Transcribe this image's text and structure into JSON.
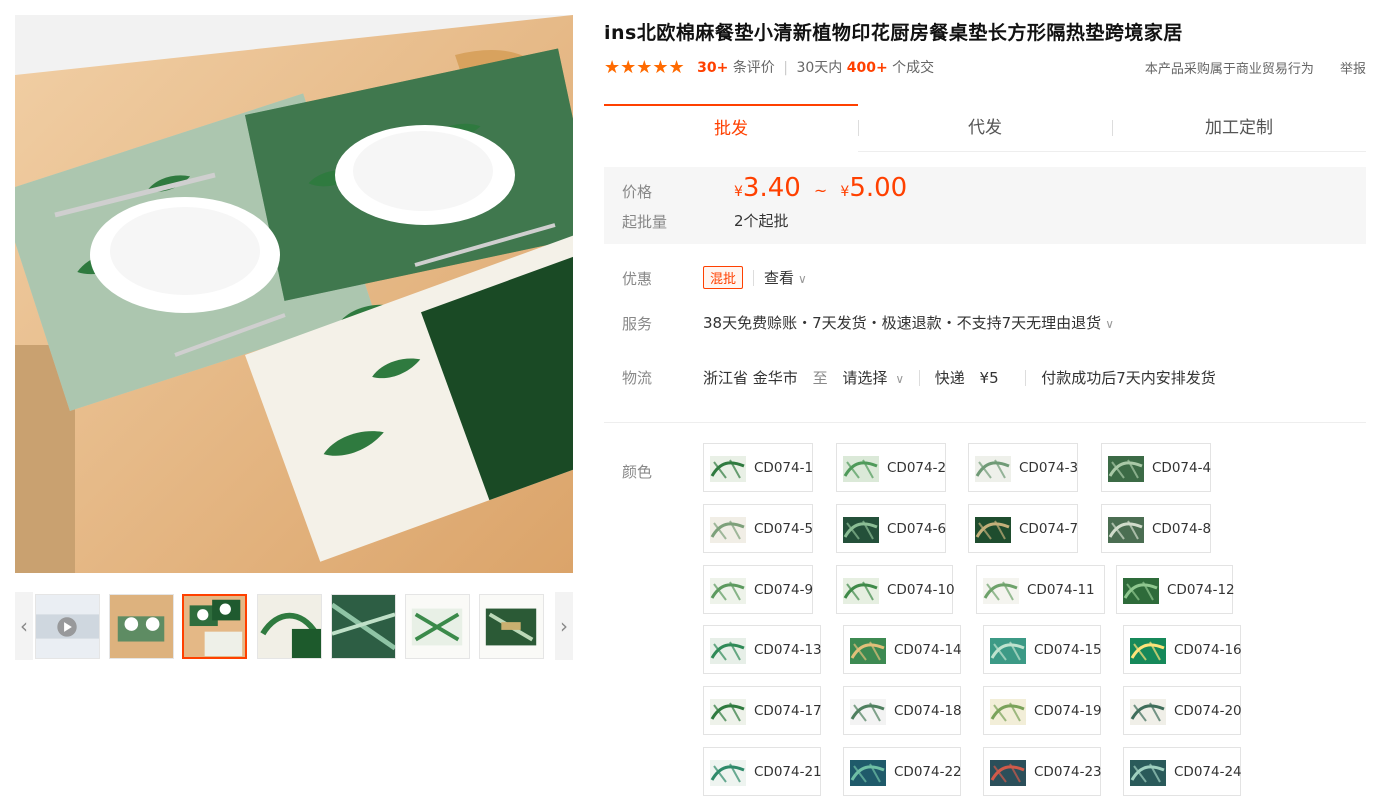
{
  "product": {
    "title": "ins北欧棉麻餐垫小清新植物印花厨房餐桌垫长方形隔热垫跨境家居",
    "stars": "★★★★★",
    "review_count": "30+",
    "review_label": "条评价",
    "period_label": "30天内",
    "sold_count": "400+",
    "sold_label": "个成交"
  },
  "meta_links": {
    "trade_notice": "本产品采购属于商业贸易行为",
    "report": "举报"
  },
  "tabs": [
    {
      "label": "批发",
      "active": true
    },
    {
      "label": "代发",
      "active": false
    },
    {
      "label": "加工定制",
      "active": false
    }
  ],
  "price": {
    "label": "价格",
    "currency": "¥",
    "low": "3.40",
    "separator": "~",
    "high": "5.00",
    "min_qty_label": "起批量",
    "min_qty": "2个起批"
  },
  "promo": {
    "label": "优惠",
    "badge": "混批",
    "view": "查看"
  },
  "service": {
    "label": "服务",
    "text": "38天免费赊账・7天发货・极速退款・不支持7天无理由退货"
  },
  "logistics": {
    "label": "物流",
    "origin": "浙江省 金华市",
    "to": "至",
    "destination": "请选择",
    "method": "快递",
    "fee": "¥5",
    "ship_note": "付款成功后7天内安排发货"
  },
  "colors": {
    "label": "颜色",
    "options": [
      "CD074-1",
      "CD074-2",
      "CD074-3",
      "CD074-4",
      "CD074-5",
      "CD074-6",
      "CD074-7",
      "CD074-8",
      "CD074-9",
      "CD074-10",
      "CD074-11",
      "CD074-12",
      "CD074-13",
      "CD074-14",
      "CD074-15",
      "CD074-16",
      "CD074-17",
      "CD074-18",
      "CD074-19",
      "CD074-20",
      "CD074-21",
      "CD074-22",
      "CD074-23",
      "CD074-24"
    ]
  },
  "theme": {
    "accent": "#ff4000",
    "star_color": "#ff6a00",
    "leaf_green": "#2e6b3a",
    "table_wood": "#e7b985"
  },
  "icons": {
    "prev": "chevron-left-icon",
    "next": "chevron-right-icon",
    "play": "play-icon"
  }
}
